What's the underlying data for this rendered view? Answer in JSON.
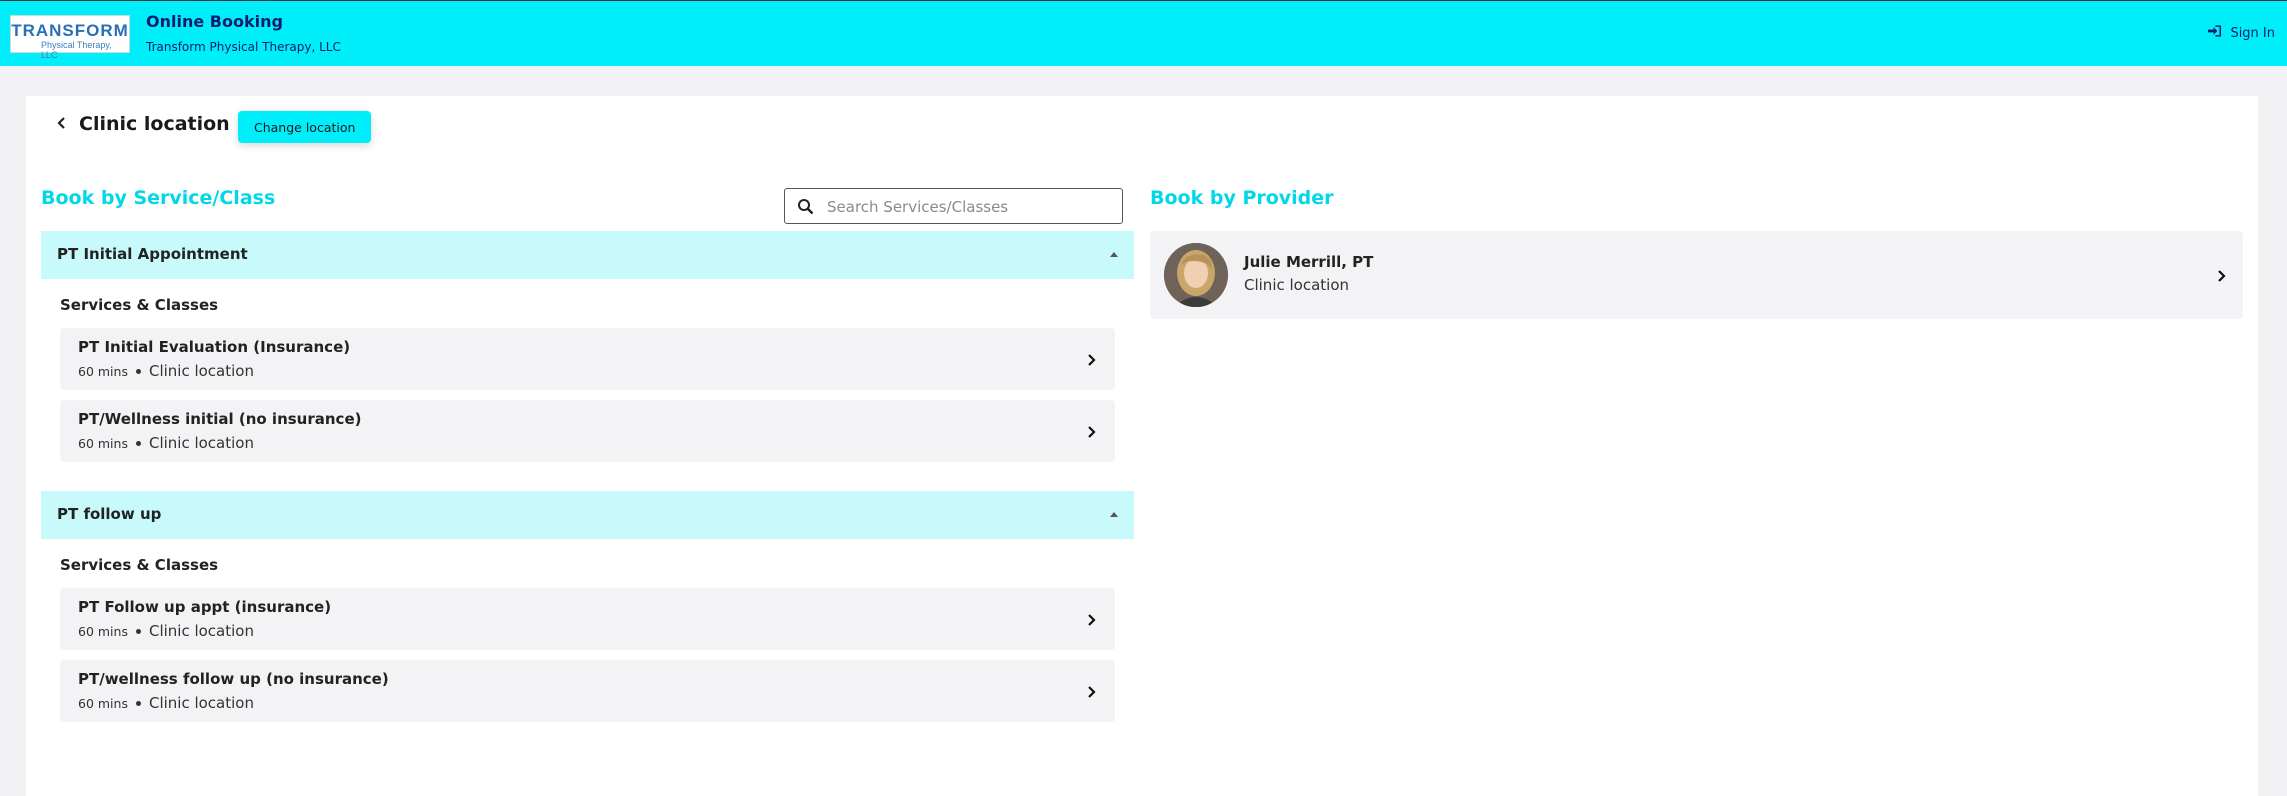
{
  "header": {
    "logo_line1": "TRANSFORM",
    "logo_line2": "Physical Therapy, LLC",
    "title": "Online Booking",
    "subtitle": "Transform Physical Therapy, LLC",
    "signin_label": "Sign In",
    "accent_color": "#00eef9"
  },
  "location": {
    "title": "Clinic location",
    "change_label": "Change location"
  },
  "services": {
    "section_title": "Book by Service/Class",
    "search_placeholder": "Search Services/Classes",
    "groups": [
      {
        "label": "PT Initial Appointment",
        "subheading": "Services & Classes",
        "items": [
          {
            "name": "PT Initial Evaluation (Insurance)",
            "duration": "60 mins",
            "location": "Clinic location"
          },
          {
            "name": "PT/Wellness initial (no insurance)",
            "duration": "60 mins",
            "location": "Clinic location"
          }
        ]
      },
      {
        "label": "PT follow up",
        "subheading": "Services & Classes",
        "items": [
          {
            "name": "PT Follow up appt (insurance)",
            "duration": "60 mins",
            "location": "Clinic location"
          },
          {
            "name": "PT/wellness follow up (no insurance)",
            "duration": "60 mins",
            "location": "Clinic location"
          }
        ]
      }
    ]
  },
  "providers": {
    "section_title": "Book by Provider",
    "items": [
      {
        "name": "Julie Merrill, PT",
        "location": "Clinic location"
      }
    ]
  }
}
